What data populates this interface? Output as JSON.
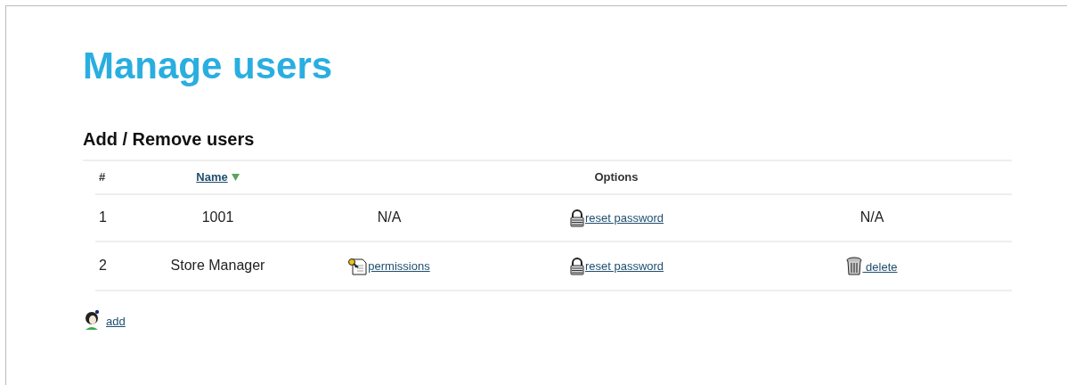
{
  "page_title": "Manage users",
  "section_title": "Add / Remove users",
  "table": {
    "columns": [
      {
        "label": "#",
        "kind": "plain"
      },
      {
        "label": "Name",
        "kind": "sortable",
        "sorted": true
      },
      {
        "kind": "blank"
      },
      {
        "label": "Options",
        "kind": "plain"
      },
      {
        "kind": "blank"
      }
    ],
    "rows": [
      {
        "cells": [
          {
            "kind": "text",
            "text": "1"
          },
          {
            "kind": "text",
            "text": "1001"
          },
          {
            "kind": "text",
            "text": "N/A"
          },
          {
            "kind": "password_link",
            "text": "reset password"
          },
          {
            "kind": "text",
            "text": "N/A"
          }
        ]
      },
      {
        "cells": [
          {
            "kind": "text",
            "text": "2"
          },
          {
            "kind": "text",
            "text": "Store Manager"
          },
          {
            "kind": "permissions_link",
            "text": "permissions"
          },
          {
            "kind": "password_link",
            "text": "reset password"
          },
          {
            "kind": "delete_link",
            "text": " delete"
          }
        ]
      }
    ]
  },
  "add_link": {
    "text": "add"
  }
}
